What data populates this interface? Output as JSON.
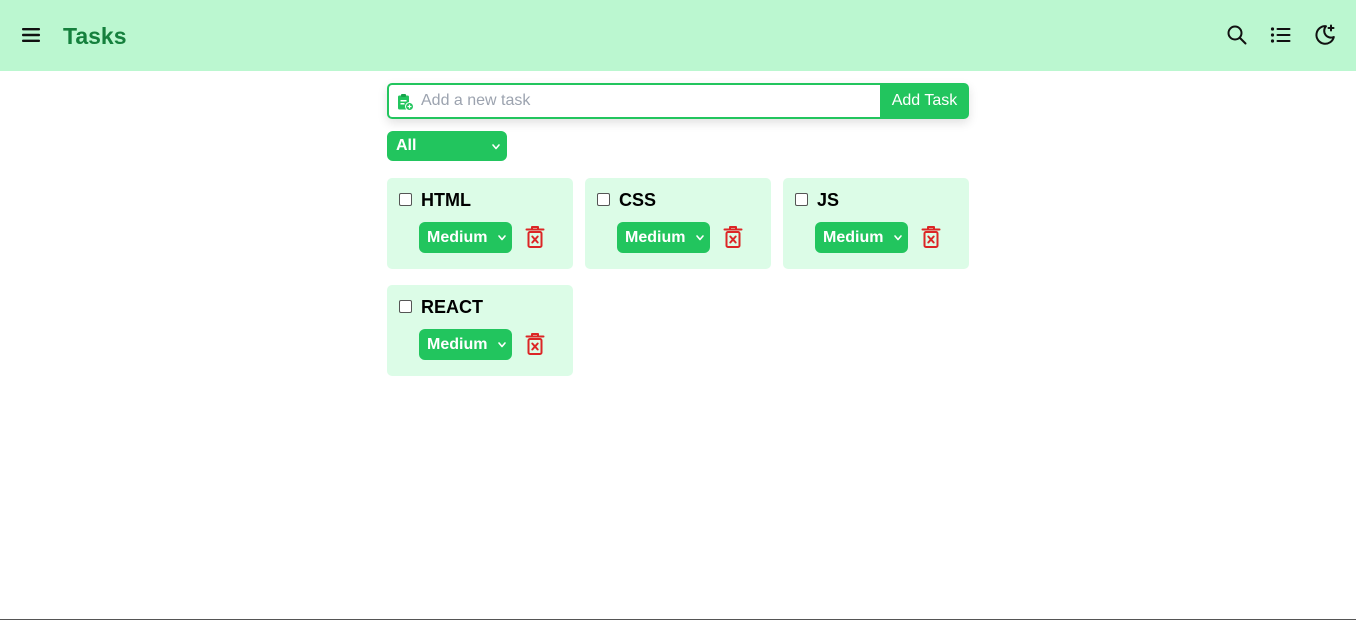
{
  "header": {
    "title": "Tasks",
    "menu_icon": "hamburger-menu-icon",
    "actions": [
      {
        "name": "search",
        "icon": "search-icon"
      },
      {
        "name": "list",
        "icon": "list-icon"
      },
      {
        "name": "theme",
        "icon": "moon-stars-icon"
      }
    ]
  },
  "add_task": {
    "placeholder": "Add a new task",
    "value": "",
    "button_label": "Add Task",
    "icon": "clipboard-add-icon"
  },
  "filter": {
    "selected": "All"
  },
  "tasks": [
    {
      "name": "HTML",
      "priority": "Medium",
      "done": false
    },
    {
      "name": "CSS",
      "priority": "Medium",
      "done": false
    },
    {
      "name": "JS",
      "priority": "Medium",
      "done": false
    },
    {
      "name": "REACT",
      "priority": "Medium",
      "done": false
    }
  ],
  "colors": {
    "header_bg": "#bbf7d0",
    "accent": "#22c55e",
    "title": "#15803d",
    "card_bg": "#dcfce7",
    "delete": "#dc2626"
  }
}
